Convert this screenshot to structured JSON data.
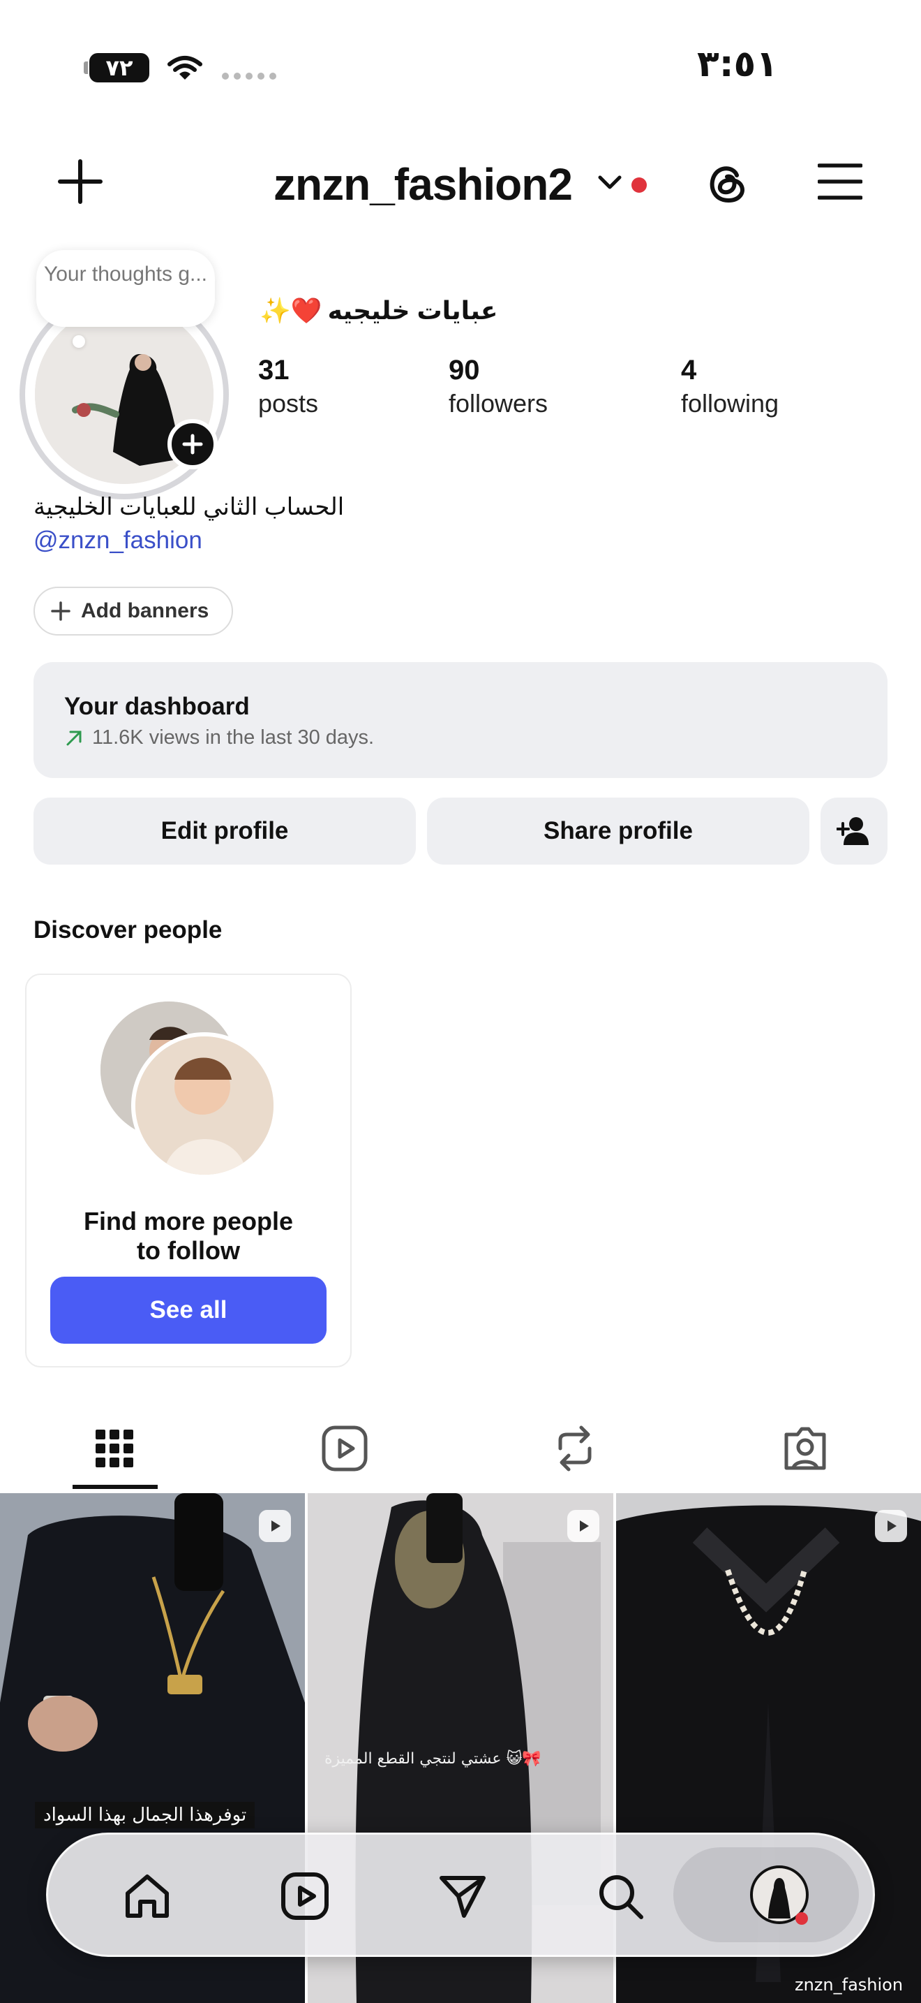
{
  "status_bar": {
    "battery": "٧٢",
    "time": "٣:٥١",
    "icons": [
      "battery-icon",
      "wifi-icon",
      "cellular-icon"
    ]
  },
  "header": {
    "username": "znzn_fashion2",
    "icons": [
      "plus-icon",
      "chevron-down-icon",
      "threads-icon",
      "menu-icon"
    ],
    "notify_color": "#e0333c"
  },
  "note_bubble": "Your thoughts g...",
  "profile": {
    "display_name": "عبايات خليجيه",
    "name_emoji": "✨❤️",
    "stats": [
      {
        "value": "31",
        "label": "posts"
      },
      {
        "value": "90",
        "label": "followers"
      },
      {
        "value": "4",
        "label": "following"
      }
    ],
    "bio": "الحساب الثاني للعبايات الخليجية",
    "mention": "@znzn_fashion",
    "add_banners": "Add banners"
  },
  "dashboard": {
    "title": "Your dashboard",
    "subtitle": "11.6K views in the last 30 days."
  },
  "actions": {
    "edit": "Edit profile",
    "share": "Share profile"
  },
  "discover": {
    "heading": "Discover people",
    "card_text": "Find more people\nto follow",
    "button": "See all"
  },
  "content_tabs": [
    "grid-icon",
    "reels-icon",
    "reposts-icon",
    "tagged-icon"
  ],
  "grid": {
    "tiles": [
      {
        "caption": "توفرهذا الجمال بهذا السواد"
      },
      {
        "caption": "🎀😺 عشتي لنتجي القطع المميزة"
      },
      {
        "caption": "",
        "watermark": "znzn_fashion"
      }
    ]
  },
  "bottom_nav": [
    "home-icon",
    "reels-icon",
    "messages-icon",
    "search-icon",
    "profile-avatar"
  ],
  "colors": {
    "accent": "#4a5cf5",
    "link": "#3a4fc8",
    "surface": "#eeeff2"
  }
}
